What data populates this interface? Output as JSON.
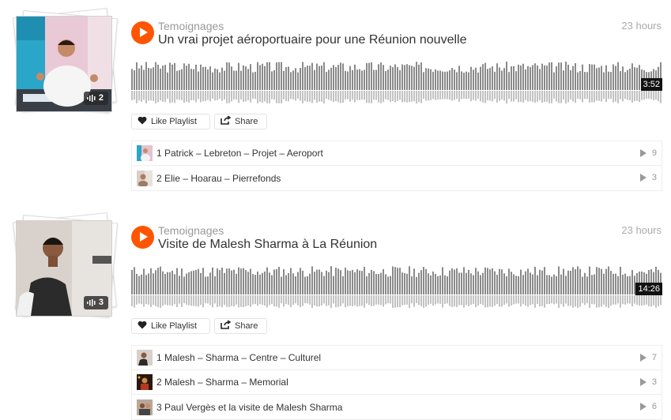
{
  "playlists": [
    {
      "user": "Temoignages",
      "title": "Un vrai projet aéroportuaire pour une Réunion nouvelle",
      "timestamp": "23 hours",
      "duration": "3:52",
      "track_count": "2",
      "like_label": "Like Playlist",
      "share_label": "Share",
      "tracks": [
        {
          "label": "1 Patrick – Lebreton – Projet – Aeroport",
          "plays": "9"
        },
        {
          "label": "2 Elie – Hoarau – Pierrefonds",
          "plays": "3"
        }
      ]
    },
    {
      "user": "Temoignages",
      "title": "Visite de Malesh Sharma à La Réunion",
      "timestamp": "23 hours",
      "duration": "14:26",
      "track_count": "3",
      "like_label": "Like Playlist",
      "share_label": "Share",
      "tracks": [
        {
          "label": "1 Malesh – Sharma – Centre – Culturel",
          "plays": "7"
        },
        {
          "label": "2 Malesh – Sharma – Memorial",
          "plays": "3"
        },
        {
          "label": "3 Paul Vergès et la visite de Malesh Sharma",
          "plays": "6"
        }
      ]
    }
  ],
  "colors": {
    "accent": "#ff5500",
    "wave_top": "#8a8a8a",
    "wave_bottom": "#c2c2c2"
  },
  "icons": [
    "play-icon",
    "heart-icon",
    "share-icon",
    "waveform-count-icon",
    "play-count-icon"
  ]
}
